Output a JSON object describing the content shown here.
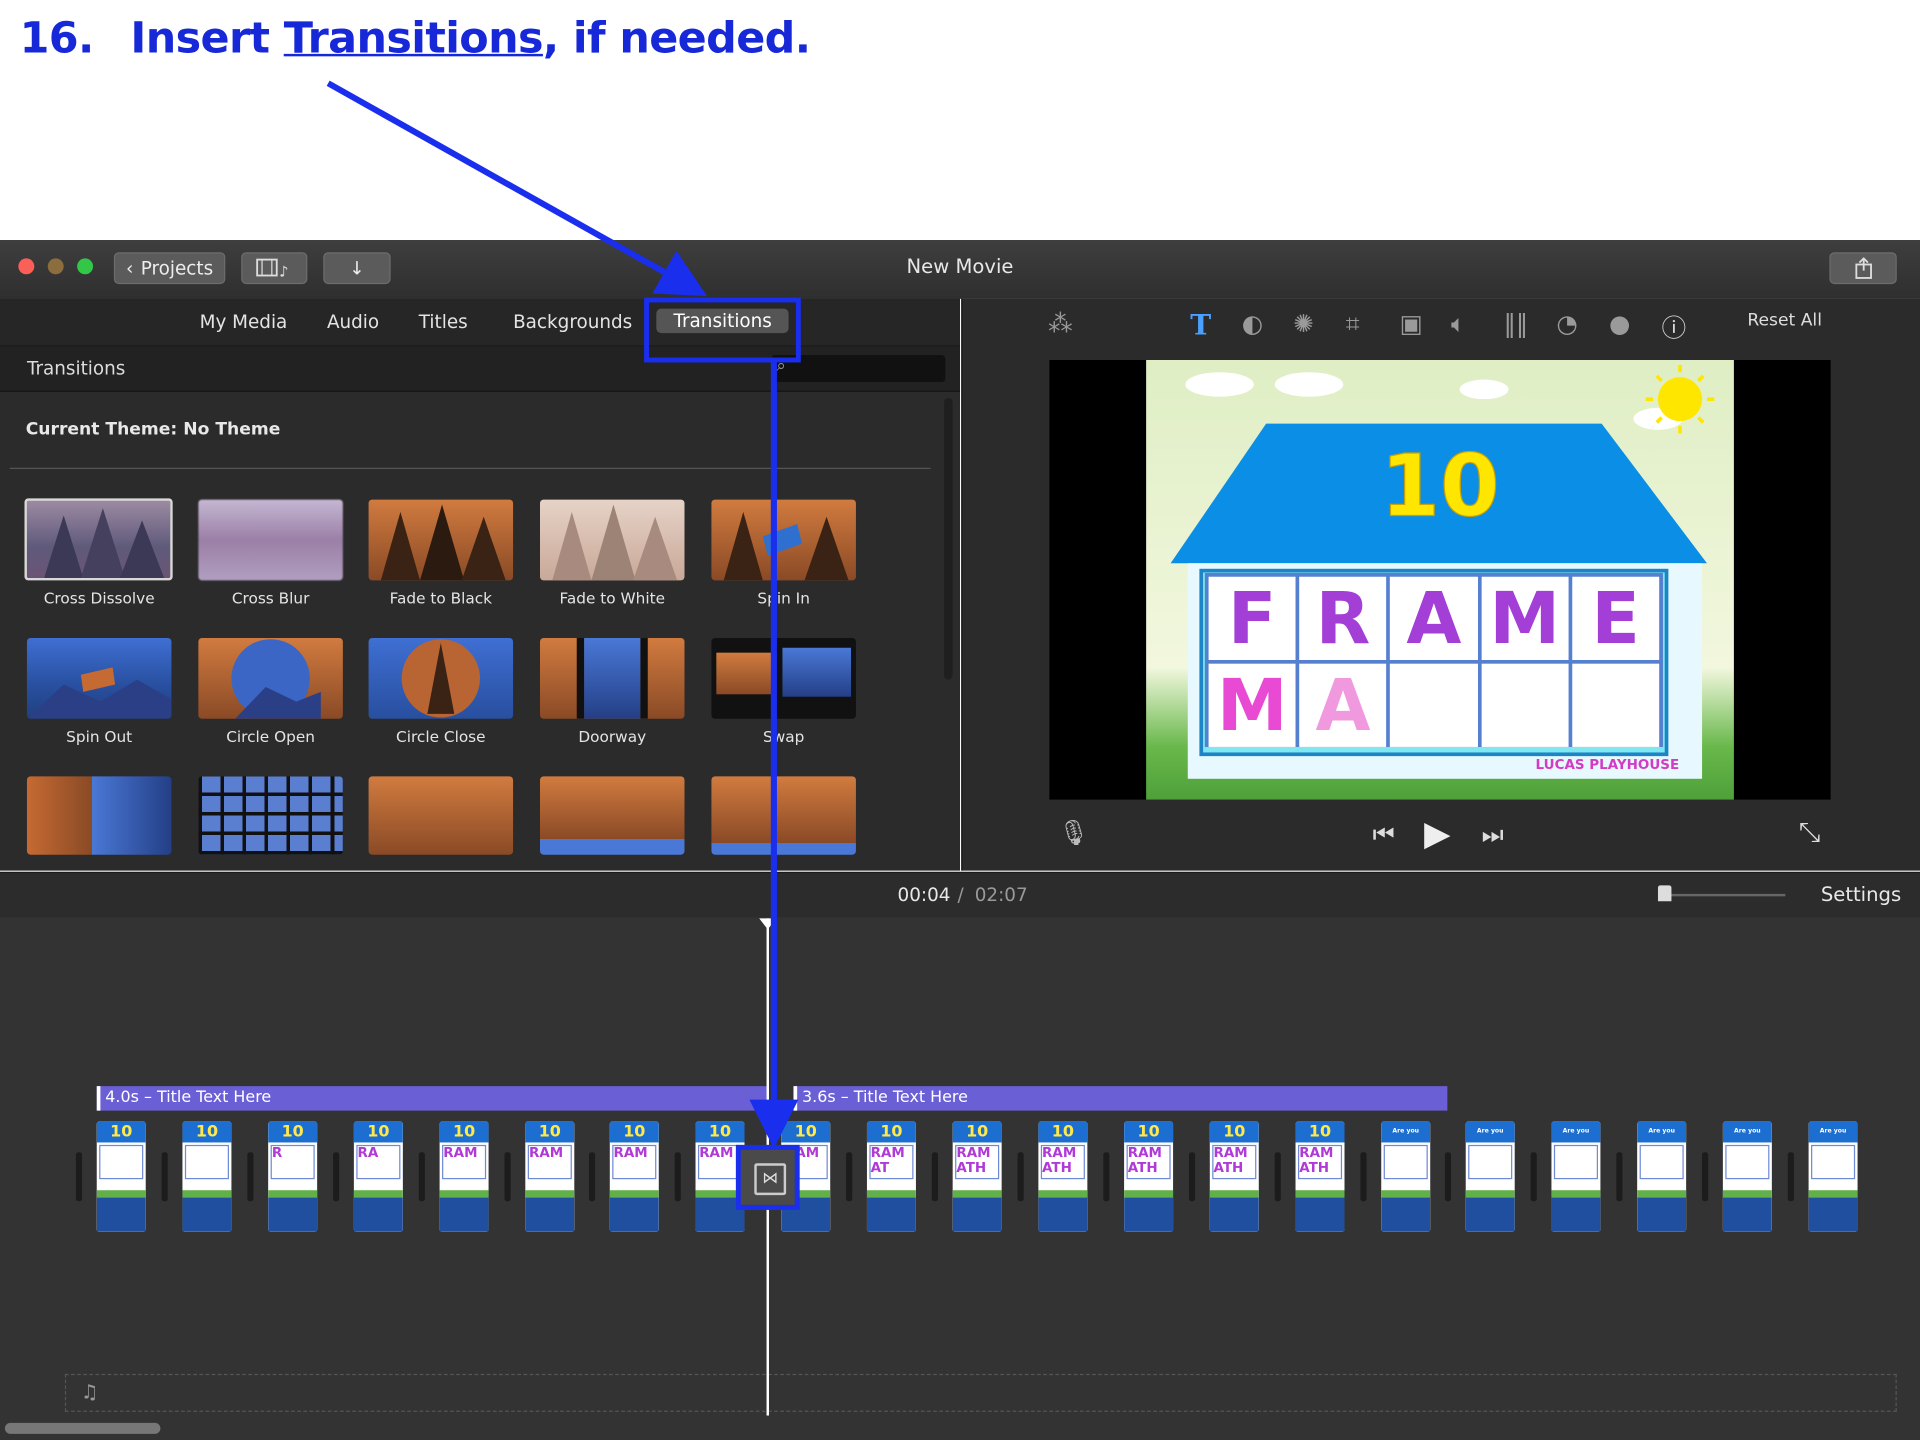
{
  "heading": {
    "number": "16.",
    "pre": "Insert ",
    "link": "Transitions",
    "post": ", if needed."
  },
  "window": {
    "title": "New Movie",
    "projects_label": "Projects"
  },
  "library": {
    "tabs": [
      "My Media",
      "Audio",
      "Titles",
      "Backgrounds",
      "Transitions"
    ],
    "active_tab": "Transitions",
    "section_title": "Transitions",
    "current_theme": "Current Theme: No Theme",
    "items": [
      "Cross Dissolve",
      "Cross Blur",
      "Fade to Black",
      "Fade to White",
      "Spin In",
      "Spin Out",
      "Circle Open",
      "Circle Close",
      "Doorway",
      "Swap"
    ]
  },
  "viewer": {
    "reset_all": "Reset All",
    "frame_number": "10",
    "row1": [
      "F",
      "R",
      "A",
      "M",
      "E"
    ],
    "row2": [
      "M",
      "A",
      "",
      "",
      ""
    ],
    "brand": "LUCAS PLAYHOUSE"
  },
  "timeline": {
    "current_time": "00:04",
    "separator": "/",
    "total_time": "02:07",
    "settings_label": "Settings",
    "title_clip_1": "4.0s – Title Text Here",
    "title_clip_2": "3.6s – Title Text Here",
    "clip_numbers": [
      "10",
      "10",
      "10",
      "10",
      "10",
      "10",
      "10",
      "10",
      "10",
      "10",
      "10",
      "10",
      "10",
      "10",
      "10"
    ],
    "ready_label": "Are you ready?"
  },
  "colors": {
    "accent": "#1a2eee",
    "title_clip": "#6b5fd6",
    "heading": "#1628d8"
  }
}
